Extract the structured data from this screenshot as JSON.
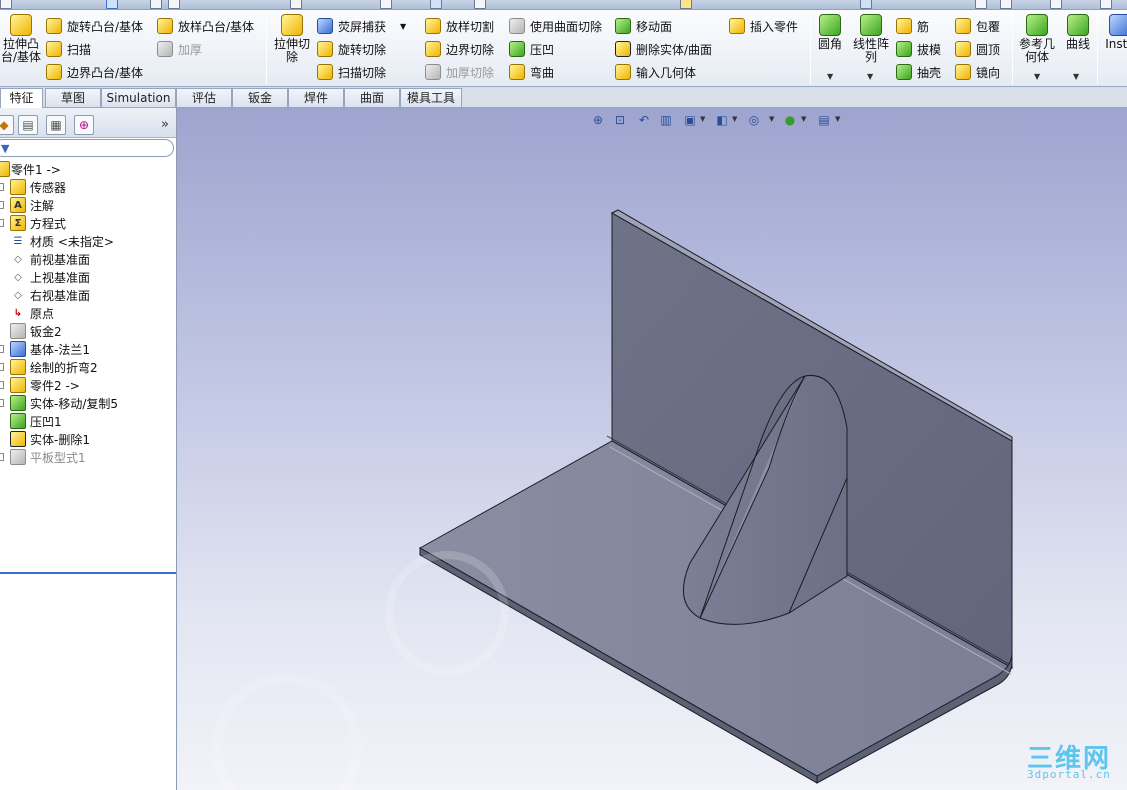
{
  "ribbon": {
    "extrude_boss": "拉伸凸\n台/基体",
    "revolve_boss": "旋转凸台/基体",
    "sweep": "扫描",
    "boundary_boss": "边界凸台/基体",
    "loft_boss": "放样凸台/基体",
    "thicken": "加厚",
    "extrude_cut": "拉伸切\n除",
    "screen_capture": "荧屏捕获",
    "revolve_cut": "旋转切除",
    "sweep_cut": "扫描切除",
    "loft_cut": "放样切割",
    "boundary_cut": "边界切除",
    "thicken_cut": "加厚切除",
    "cut_with_surface": "使用曲面切除",
    "indent": "压凹",
    "flex": "弯曲",
    "move_face": "移动面",
    "delete_body": "删除实体/曲面",
    "import_geometry": "输入几何体",
    "insert_part": "插入零件",
    "fillet": "圆角",
    "linear_pattern": "线性阵\n列",
    "rib": "筋",
    "draft": "拔模",
    "shell": "抽壳",
    "wrap": "包覆",
    "dome": "圆顶",
    "mirror": "镜向",
    "reference_geometry": "参考几\n何体",
    "curves": "曲线",
    "instant3d": "Insta"
  },
  "tabs": [
    "特征",
    "草图",
    "Simulation",
    "评估",
    "钣金",
    "焊件",
    "曲面",
    "模具工具"
  ],
  "panel": {
    "chevron": "»"
  },
  "tree": [
    {
      "label": "零件1 ->",
      "icon": "part-icon"
    },
    {
      "label": "传感器",
      "icon": "sensor-icon"
    },
    {
      "label": "注解",
      "icon": "annotation-icon"
    },
    {
      "label": "方程式",
      "icon": "equation-icon"
    },
    {
      "label": "材质 <未指定>",
      "icon": "material-icon"
    },
    {
      "label": "前视基准面",
      "icon": "plane-icon"
    },
    {
      "label": "上视基准面",
      "icon": "plane-icon"
    },
    {
      "label": "右视基准面",
      "icon": "plane-icon"
    },
    {
      "label": "原点",
      "icon": "origin-icon"
    },
    {
      "label": "钣金2",
      "icon": "sheetmetal-icon"
    },
    {
      "label": "基体-法兰1",
      "icon": "base-flange-icon"
    },
    {
      "label": "绘制的折弯2",
      "icon": "sketched-bend-icon"
    },
    {
      "label": "零件2 ->",
      "icon": "part-icon"
    },
    {
      "label": "实体-移动/复制5",
      "icon": "move-copy-icon"
    },
    {
      "label": "压凹1",
      "icon": "indent-icon"
    },
    {
      "label": "实体-删除1",
      "icon": "delete-body-icon"
    },
    {
      "label": "平板型式1",
      "icon": "flat-pattern-icon"
    }
  ],
  "watermark": {
    "line1": "三维网",
    "line2": "3dportal.cn"
  },
  "colors": {
    "viewport_top": "#9da5cf",
    "viewport_bottom": "#f2f3f9",
    "model_face": "#7b7f95",
    "accent": "#3a6fc9"
  }
}
